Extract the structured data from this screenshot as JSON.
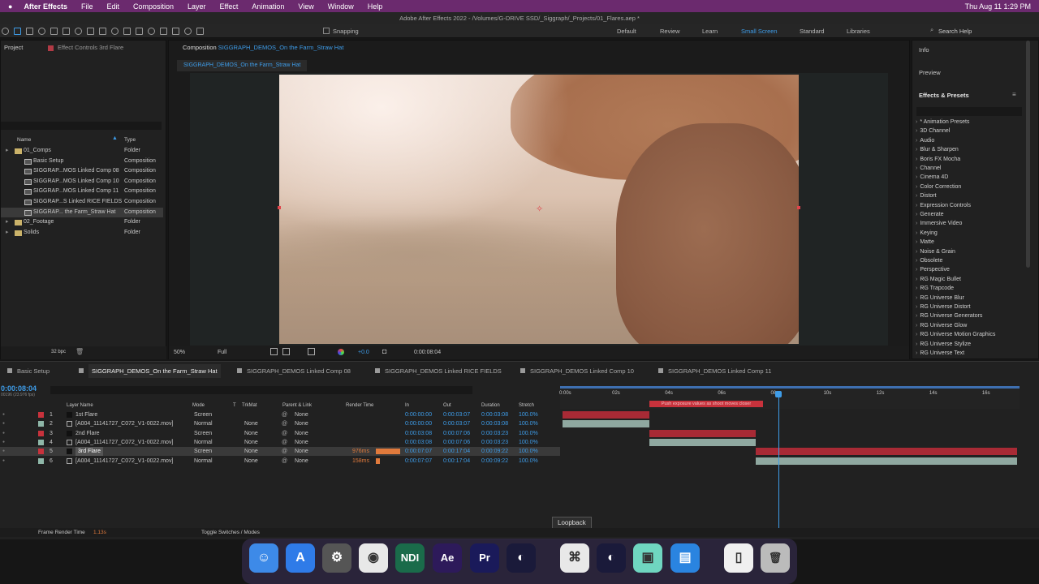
{
  "menubar": {
    "apple": "",
    "app": "After Effects",
    "items": [
      "File",
      "Edit",
      "Composition",
      "Layer",
      "Effect",
      "Animation",
      "View",
      "Window",
      "Help"
    ],
    "clock": "Thu Aug 11  1:29 PM"
  },
  "title": "Adobe After Effects 2022 - /Volumes/G-DRIVE SSD/_Siggraph/_Projects/01_Flares.aep *",
  "toolbar": {
    "snapping": "Snapping",
    "workspaces": [
      "Default",
      "Review",
      "Learn",
      "Small Screen",
      "Standard",
      "Libraries"
    ],
    "active_workspace": "Small Screen",
    "search_placeholder": "Search Help"
  },
  "project": {
    "tab": "Project",
    "effect_controls": "Effect Controls 3rd Flare",
    "col_name": "Name",
    "col_type": "Type",
    "items": [
      {
        "name": "01_Comps",
        "type": "Folder",
        "indent": 0
      },
      {
        "name": "Basic Setup",
        "type": "Composition",
        "indent": 1
      },
      {
        "name": "SIGGRAP...MOS Linked Comp 08",
        "type": "Composition",
        "indent": 1
      },
      {
        "name": "SIGGRAP...MOS Linked Comp 10",
        "type": "Composition",
        "indent": 1
      },
      {
        "name": "SIGGRAP...MOS Linked Comp 11",
        "type": "Composition",
        "indent": 1
      },
      {
        "name": "SIGGRAP...S Linked RICE FIELDS",
        "type": "Composition",
        "indent": 1
      },
      {
        "name": "SIGGRAP... the Farm_Straw Hat",
        "type": "Composition",
        "indent": 1
      },
      {
        "name": "02_Footage",
        "type": "Folder",
        "indent": 0
      },
      {
        "name": "Solids",
        "type": "Folder",
        "indent": 0
      }
    ],
    "bpc": "32 bpc"
  },
  "comp": {
    "tab_prefix": "Composition",
    "tab_name": "SIGGRAPH_DEMOS_On the Farm_Straw Hat",
    "breadcrumb": "SIGGRAPH_DEMOS_On the Farm_Straw Hat",
    "zoom": "50%",
    "resolution": "Full",
    "exposure": "+0.0",
    "timecode": "0:00:08:04"
  },
  "right": {
    "info": "Info",
    "preview": "Preview",
    "effects_title": "Effects & Presets",
    "effects": [
      "* Animation Presets",
      "3D Channel",
      "Audio",
      "Blur & Sharpen",
      "Boris FX Mocha",
      "Channel",
      "Cinema 4D",
      "Color Correction",
      "Distort",
      "Expression Controls",
      "Generate",
      "Immersive Video",
      "Keying",
      "Matte",
      "Noise & Grain",
      "Obsolete",
      "Perspective",
      "RG Magic Bullet",
      "RG Trapcode",
      "RG Universe Blur",
      "RG Universe Distort",
      "RG Universe Generators",
      "RG Universe Glow",
      "RG Universe Motion Graphics",
      "RG Universe Stylize",
      "RG Universe Text"
    ]
  },
  "timeline": {
    "tabs": [
      "Basic Setup",
      "SIGGRAPH_DEMOS_On the Farm_Straw Hat",
      "SIGGRAPH_DEMOS Linked Comp 08",
      "SIGGRAPH_DEMOS Linked RICE FIELDS",
      "SIGGRAPH_DEMOS Linked Comp 10",
      "SIGGRAPH_DEMOS Linked Comp 11"
    ],
    "timecode": "0:00:08:04",
    "frame": "00196 (23.976 fps)",
    "headers": {
      "layer_name": "Layer Name",
      "mode": "Mode",
      "t": "T",
      "trkmat": "TrkMat",
      "parent": "Parent & Link",
      "render_time": "Render Time",
      "in": "In",
      "out": "Out",
      "duration": "Duration",
      "stretch": "Stretch"
    },
    "ruler": [
      "0:00s",
      "02s",
      "04s",
      "06s",
      "08s",
      "10s",
      "12s",
      "14s",
      "16s"
    ],
    "marker": "Push exposure values as shoot moves closer",
    "layers": [
      {
        "num": "1",
        "name": "1st Flare",
        "mode": "Screen",
        "trkmat": "",
        "parent": "None",
        "render": "",
        "in": "0:00:00:00",
        "out": "0:00:03:07",
        "dur": "0:00:03:08",
        "stretch": "100.0%",
        "color": "#c8323c",
        "bar_start_s": 0,
        "bar_end_s": 3.3
      },
      {
        "num": "2",
        "name": "[A004_11141727_C072_V1-0022.mov]",
        "mode": "Normal",
        "trkmat": "None",
        "parent": "None",
        "render": "",
        "in": "0:00:00:00",
        "out": "0:00:03:07",
        "dur": "0:00:03:08",
        "stretch": "100.0%",
        "color": "#8fb7a8",
        "bar_start_s": 0,
        "bar_end_s": 3.3
      },
      {
        "num": "3",
        "name": "2nd Flare",
        "mode": "Screen",
        "trkmat": "None",
        "parent": "None",
        "render": "",
        "in": "0:00:03:08",
        "out": "0:00:07:06",
        "dur": "0:00:03:23",
        "stretch": "100.0%",
        "color": "#c8323c",
        "bar_start_s": 3.3,
        "bar_end_s": 7.3
      },
      {
        "num": "4",
        "name": "[A004_11141727_C072_V1-0022.mov]",
        "mode": "Normal",
        "trkmat": "None",
        "parent": "None",
        "render": "",
        "in": "0:00:03:08",
        "out": "0:00:07:06",
        "dur": "0:00:03:23",
        "stretch": "100.0%",
        "color": "#8fb7a8",
        "bar_start_s": 3.3,
        "bar_end_s": 7.3
      },
      {
        "num": "5",
        "name": "3rd Flare",
        "mode": "Screen",
        "trkmat": "None",
        "parent": "None",
        "render": "976ms",
        "in": "0:00:07:07",
        "out": "0:00:17:04",
        "dur": "0:00:09:22",
        "stretch": "100.0%",
        "color": "#c8323c",
        "bar_start_s": 7.3,
        "bar_end_s": 17.2,
        "selected": true
      },
      {
        "num": "6",
        "name": "[A004_11141727_C072_V1-0022.mov]",
        "mode": "Normal",
        "trkmat": "None",
        "parent": "None",
        "render": "158ms",
        "in": "0:00:07:07",
        "out": "0:00:17:04",
        "dur": "0:00:09:22",
        "stretch": "100.0%",
        "color": "#8fb7a8",
        "bar_start_s": 7.3,
        "bar_end_s": 17.2
      }
    ],
    "footer_render": "Frame Render Time",
    "footer_render_val": "1.13s",
    "toggle": "Toggle Switches / Modes",
    "tooltip": "Loopback",
    "playhead_s": 8.17,
    "render_5_frac": 0.86,
    "render_6_frac": 0.14
  },
  "dock": {
    "items": [
      "Finder",
      "App Store",
      "System Preferences",
      "Chrome",
      "NDI",
      "Ae",
      "Pr",
      "Cinema 4D",
      "Creative Cloud",
      "Cinema 4D Lite",
      "Plugin Scan",
      "Keynote",
      "Preview",
      "Trash"
    ]
  }
}
